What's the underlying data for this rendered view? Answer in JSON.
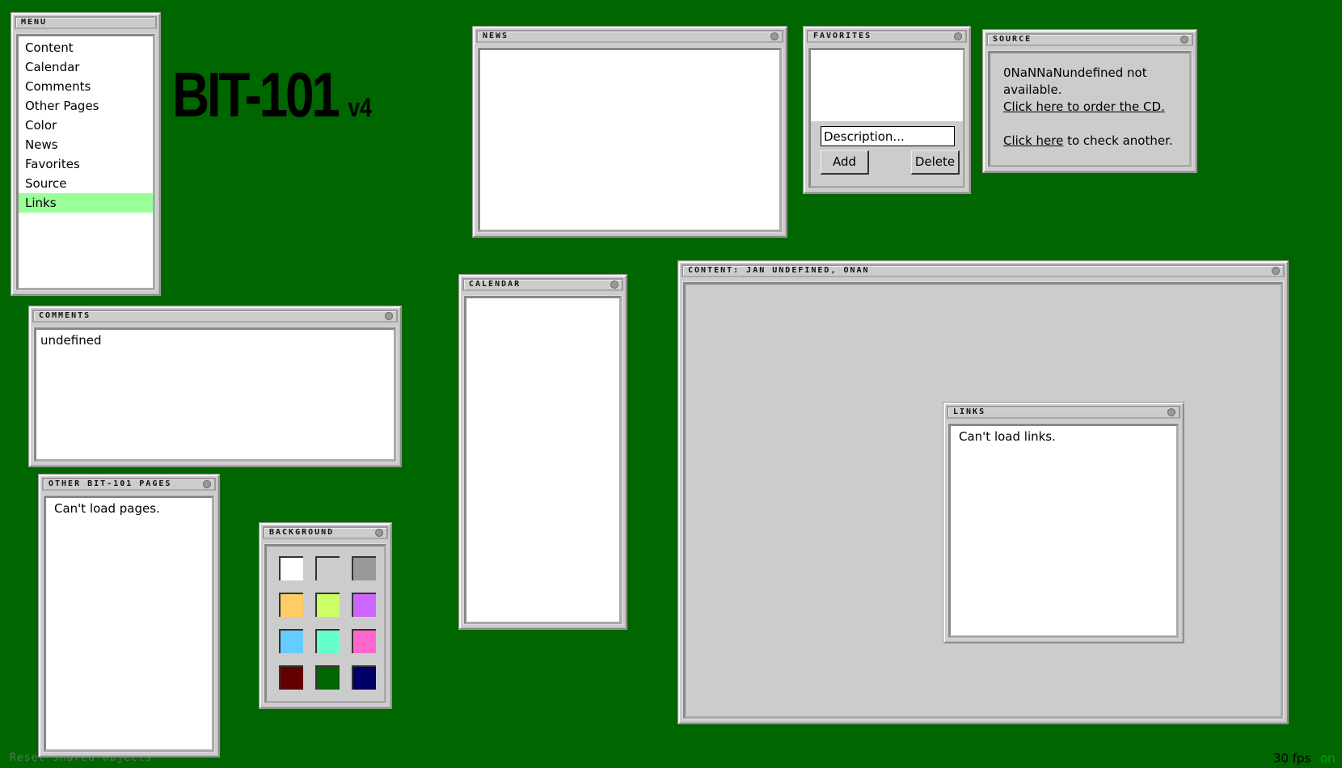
{
  "logo": {
    "title": "BIT-101",
    "version": "v4"
  },
  "menu": {
    "title": "MENU",
    "items": [
      {
        "label": "Content",
        "active": false
      },
      {
        "label": "Calendar",
        "active": false
      },
      {
        "label": "Comments",
        "active": false
      },
      {
        "label": "Other Pages",
        "active": false
      },
      {
        "label": "Color",
        "active": false
      },
      {
        "label": "News",
        "active": false
      },
      {
        "label": "Favorites",
        "active": false
      },
      {
        "label": "Source",
        "active": false
      },
      {
        "label": "Links",
        "active": true
      }
    ]
  },
  "news": {
    "title": "NEWS"
  },
  "favorites": {
    "title": "FAVORITES",
    "description_placeholder": "Description...",
    "description_value": "Description...",
    "add_label": "Add",
    "delete_label": "Delete"
  },
  "source": {
    "title": "SOURCE",
    "line1": "0NaNNaNundefined not available.",
    "order_link": "Click here to order the CD.",
    "check_link": "Click here",
    "check_rest": " to check another."
  },
  "comments": {
    "title": "COMMENTS",
    "text": "undefined"
  },
  "calendar": {
    "title": "CALENDAR"
  },
  "content": {
    "title": "CONTENT: JAN UNDEFINED, ONAN"
  },
  "links": {
    "title": "LINKS",
    "text": "Can't load links."
  },
  "other_pages": {
    "title": "OTHER BIT-101 PAGES",
    "text": "Can't load pages."
  },
  "background": {
    "title": "BACKGROUND",
    "swatches": [
      "#FFFFFF",
      "#CCCCCC",
      "#999999",
      "#FFCC66",
      "#CCFF66",
      "#CC66FF",
      "#66CCFF",
      "#66FFCC",
      "#FF66CC",
      "#660000",
      "#006600",
      "#000066"
    ]
  },
  "footer": {
    "reset_label": "Reset Shared Objects",
    "fps": "30 fps",
    "status": "on"
  }
}
